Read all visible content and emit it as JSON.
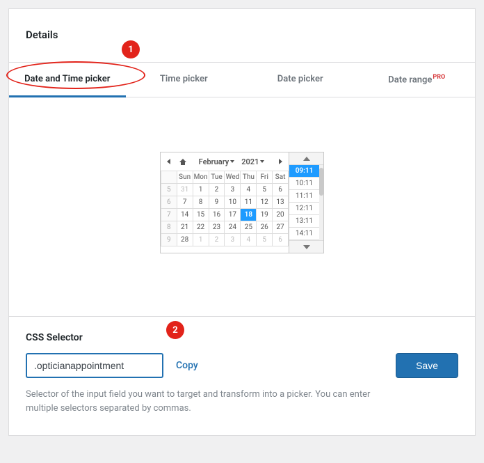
{
  "header": {
    "title": "Details"
  },
  "tabs": [
    {
      "label": "Date and Time picker",
      "active": true
    },
    {
      "label": "Time picker"
    },
    {
      "label": "Date picker"
    },
    {
      "label": "Date range",
      "pro": "PRO"
    }
  ],
  "annotations": {
    "badge1": "1",
    "badge2": "2"
  },
  "calendar": {
    "month": "February",
    "year": "2021",
    "dow": [
      "Sun",
      "Mon",
      "Tue",
      "Wed",
      "Thu",
      "Fri",
      "Sat"
    ],
    "week_nums": [
      "5",
      "6",
      "7",
      "8",
      "9"
    ],
    "rows": [
      [
        {
          "v": "31",
          "o": true
        },
        {
          "v": "1"
        },
        {
          "v": "2"
        },
        {
          "v": "3"
        },
        {
          "v": "4"
        },
        {
          "v": "5"
        },
        {
          "v": "6"
        }
      ],
      [
        {
          "v": "7"
        },
        {
          "v": "8"
        },
        {
          "v": "9"
        },
        {
          "v": "10"
        },
        {
          "v": "11"
        },
        {
          "v": "12"
        },
        {
          "v": "13"
        }
      ],
      [
        {
          "v": "14"
        },
        {
          "v": "15"
        },
        {
          "v": "16"
        },
        {
          "v": "17"
        },
        {
          "v": "18",
          "sel": true
        },
        {
          "v": "19"
        },
        {
          "v": "20"
        }
      ],
      [
        {
          "v": "21"
        },
        {
          "v": "22"
        },
        {
          "v": "23"
        },
        {
          "v": "24"
        },
        {
          "v": "25"
        },
        {
          "v": "26"
        },
        {
          "v": "27"
        }
      ],
      [
        {
          "v": "28"
        },
        {
          "v": "1",
          "o": true
        },
        {
          "v": "2",
          "o": true
        },
        {
          "v": "3",
          "o": true
        },
        {
          "v": "4",
          "o": true
        },
        {
          "v": "5",
          "o": true
        },
        {
          "v": "6",
          "o": true
        }
      ]
    ],
    "times": [
      {
        "v": "09:11",
        "sel": true
      },
      {
        "v": "10:11"
      },
      {
        "v": "11:11"
      },
      {
        "v": "12:11"
      },
      {
        "v": "13:11"
      },
      {
        "v": "14:11"
      }
    ]
  },
  "footer": {
    "label": "CSS Selector",
    "value": ".opticianappointment",
    "copy": "Copy",
    "save": "Save",
    "help": "Selector of the input field you want to target and transform into a picker. You can enter multiple selectors separated by commas."
  }
}
